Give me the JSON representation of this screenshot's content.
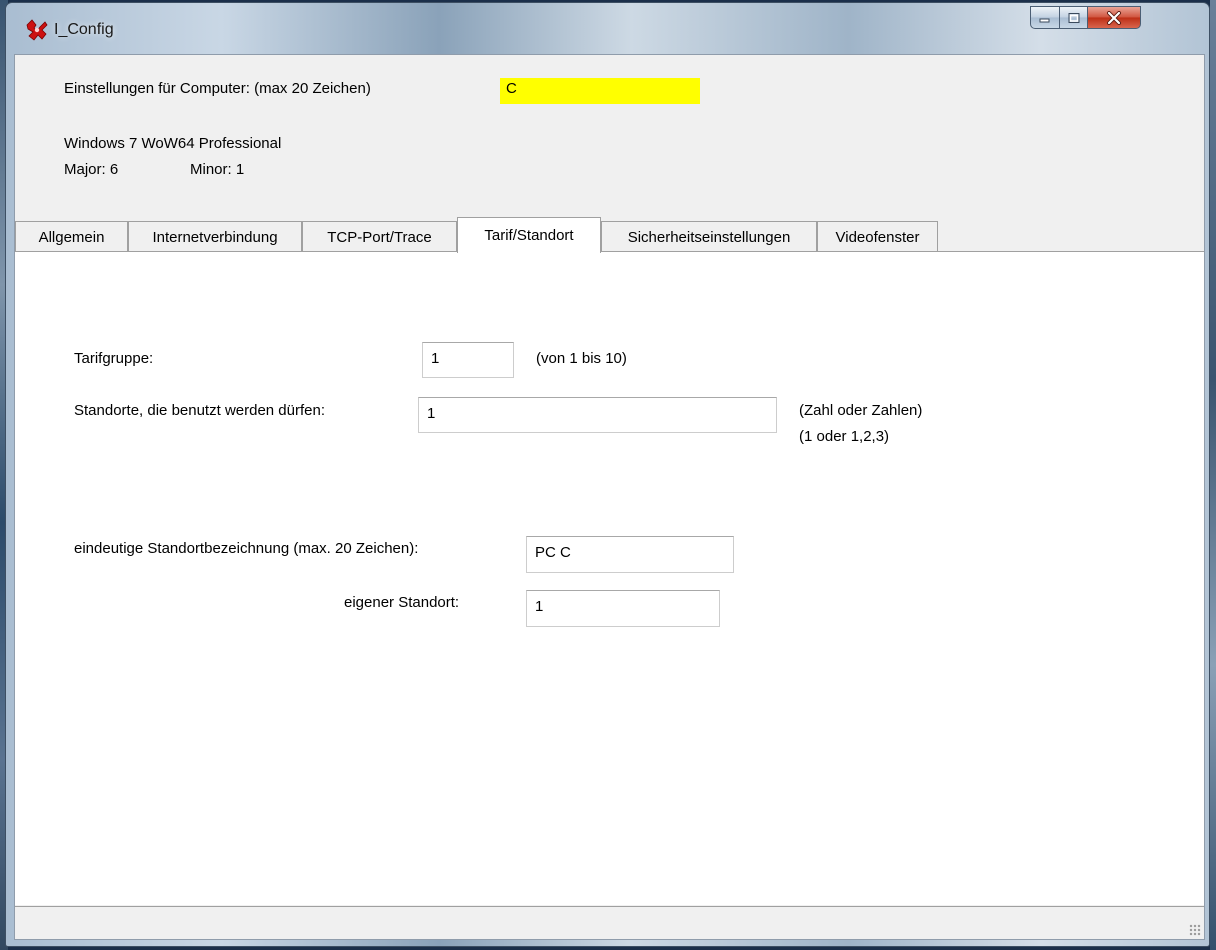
{
  "window": {
    "title": "I_Config",
    "controls": {
      "minimize": "minimize",
      "maximize": "maximize",
      "close": "close"
    }
  },
  "header": {
    "computer_label": "Einstellungen für Computer: (max 20 Zeichen)",
    "computer_value": "C",
    "os_name": "Windows 7 WoW64 Professional",
    "major_label": "Major: 6",
    "minor_label": "Minor: 1"
  },
  "tabs": [
    {
      "label": "Allgemein",
      "active": false
    },
    {
      "label": "Internetverbindung",
      "active": false
    },
    {
      "label": "TCP-Port/Trace",
      "active": false
    },
    {
      "label": "Tarif/Standort",
      "active": true
    },
    {
      "label": "Sicherheitseinstellungen",
      "active": false
    },
    {
      "label": "Videofenster",
      "active": false
    }
  ],
  "tarif": {
    "tarifgruppe_label": "Tarifgruppe:",
    "tarifgruppe_value": "1",
    "tarifgruppe_hint": "(von 1 bis 10)",
    "standorte_label": "Standorte, die benutzt werden dürfen:",
    "standorte_value": "1",
    "standorte_hint1": "(Zahl oder Zahlen)",
    "standorte_hint2": "(1 oder 1,2,3)",
    "bezeichnung_label": "eindeutige Standortbezeichnung (max. 20 Zeichen):",
    "bezeichnung_value": "PC C",
    "eigener_label": "eigener Standort:",
    "eigener_value": "1"
  },
  "colors": {
    "highlight_field": "#ffff00",
    "close_button": "#c83d24",
    "app_icon": "#cc1111"
  }
}
